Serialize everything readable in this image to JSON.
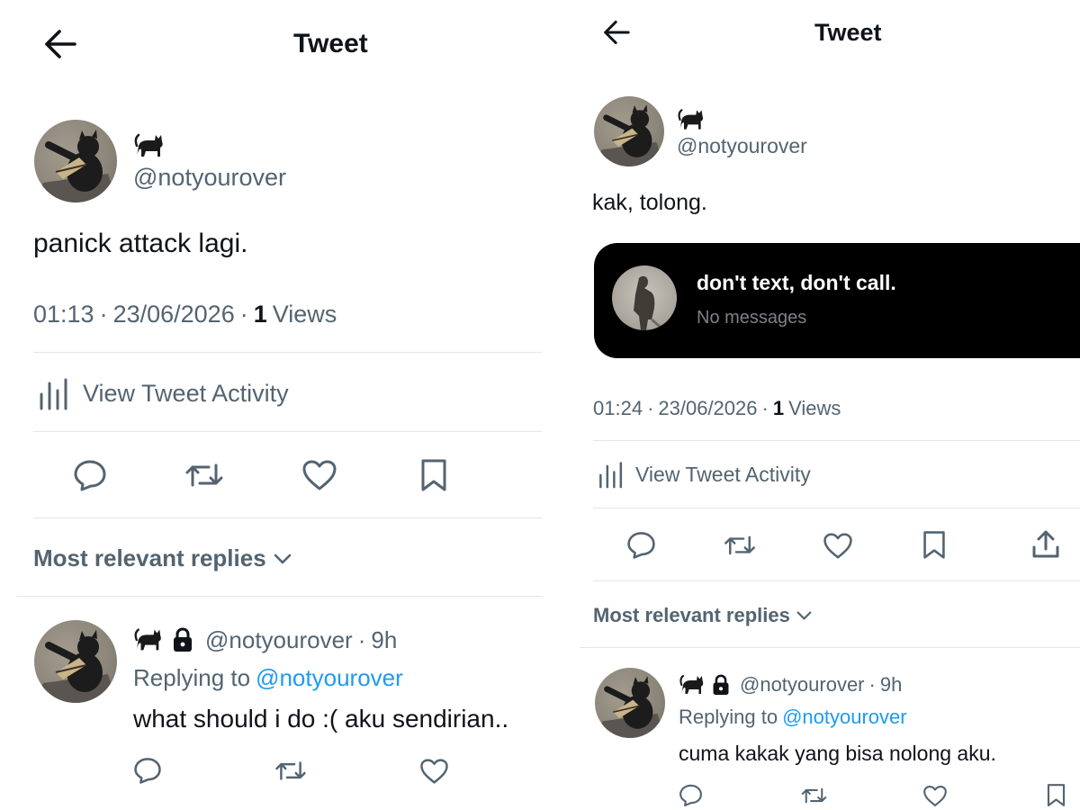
{
  "left": {
    "header_title": "Tweet",
    "author": {
      "name_emoji": "🐈‍⬛",
      "handle": "@notyourover"
    },
    "tweet_text": "panick attack lagi.",
    "meta": {
      "time": "01:13",
      "date": "23/06/2026",
      "views_count": "1",
      "views_label": "Views",
      "separator": "·"
    },
    "activity_label": "View Tweet Activity",
    "replies_sort_label": "Most relevant replies",
    "reply": {
      "handle": "@notyourover",
      "time": "9h",
      "replying_to_label": "Replying to",
      "replying_to_handle": "@notyourover",
      "text": "what should i do :( aku sendirian.."
    }
  },
  "right": {
    "header_title": "Tweet",
    "author": {
      "name_emoji": "🐈‍⬛",
      "handle": "@notyourover"
    },
    "tweet_text": "kak, tolong.",
    "dm_card": {
      "title": "don't text, don't call.",
      "subtitle": "No messages"
    },
    "meta": {
      "time": "01:24",
      "date": "23/06/2026",
      "views_count": "1",
      "views_label": "Views",
      "separator": "·"
    },
    "activity_label": "View Tweet Activity",
    "replies_sort_label": "Most relevant replies",
    "reply": {
      "handle": "@notyourover",
      "time": "9h",
      "replying_to_label": "Replying to",
      "replying_to_handle": "@notyourover",
      "text": "cuma kakak yang bisa nolong aku."
    }
  },
  "colors": {
    "text_primary": "#0f1419",
    "text_secondary": "#536471",
    "link": "#1d9bf0",
    "divider": "#e1e6ea",
    "dm_card_bg": "#000000"
  },
  "icons": [
    "back-arrow-icon",
    "cat-emoji-icon",
    "lock-icon",
    "bar-chart-icon",
    "reply-icon",
    "retweet-icon",
    "like-icon",
    "bookmark-icon",
    "share-icon",
    "chevron-down-icon"
  ]
}
